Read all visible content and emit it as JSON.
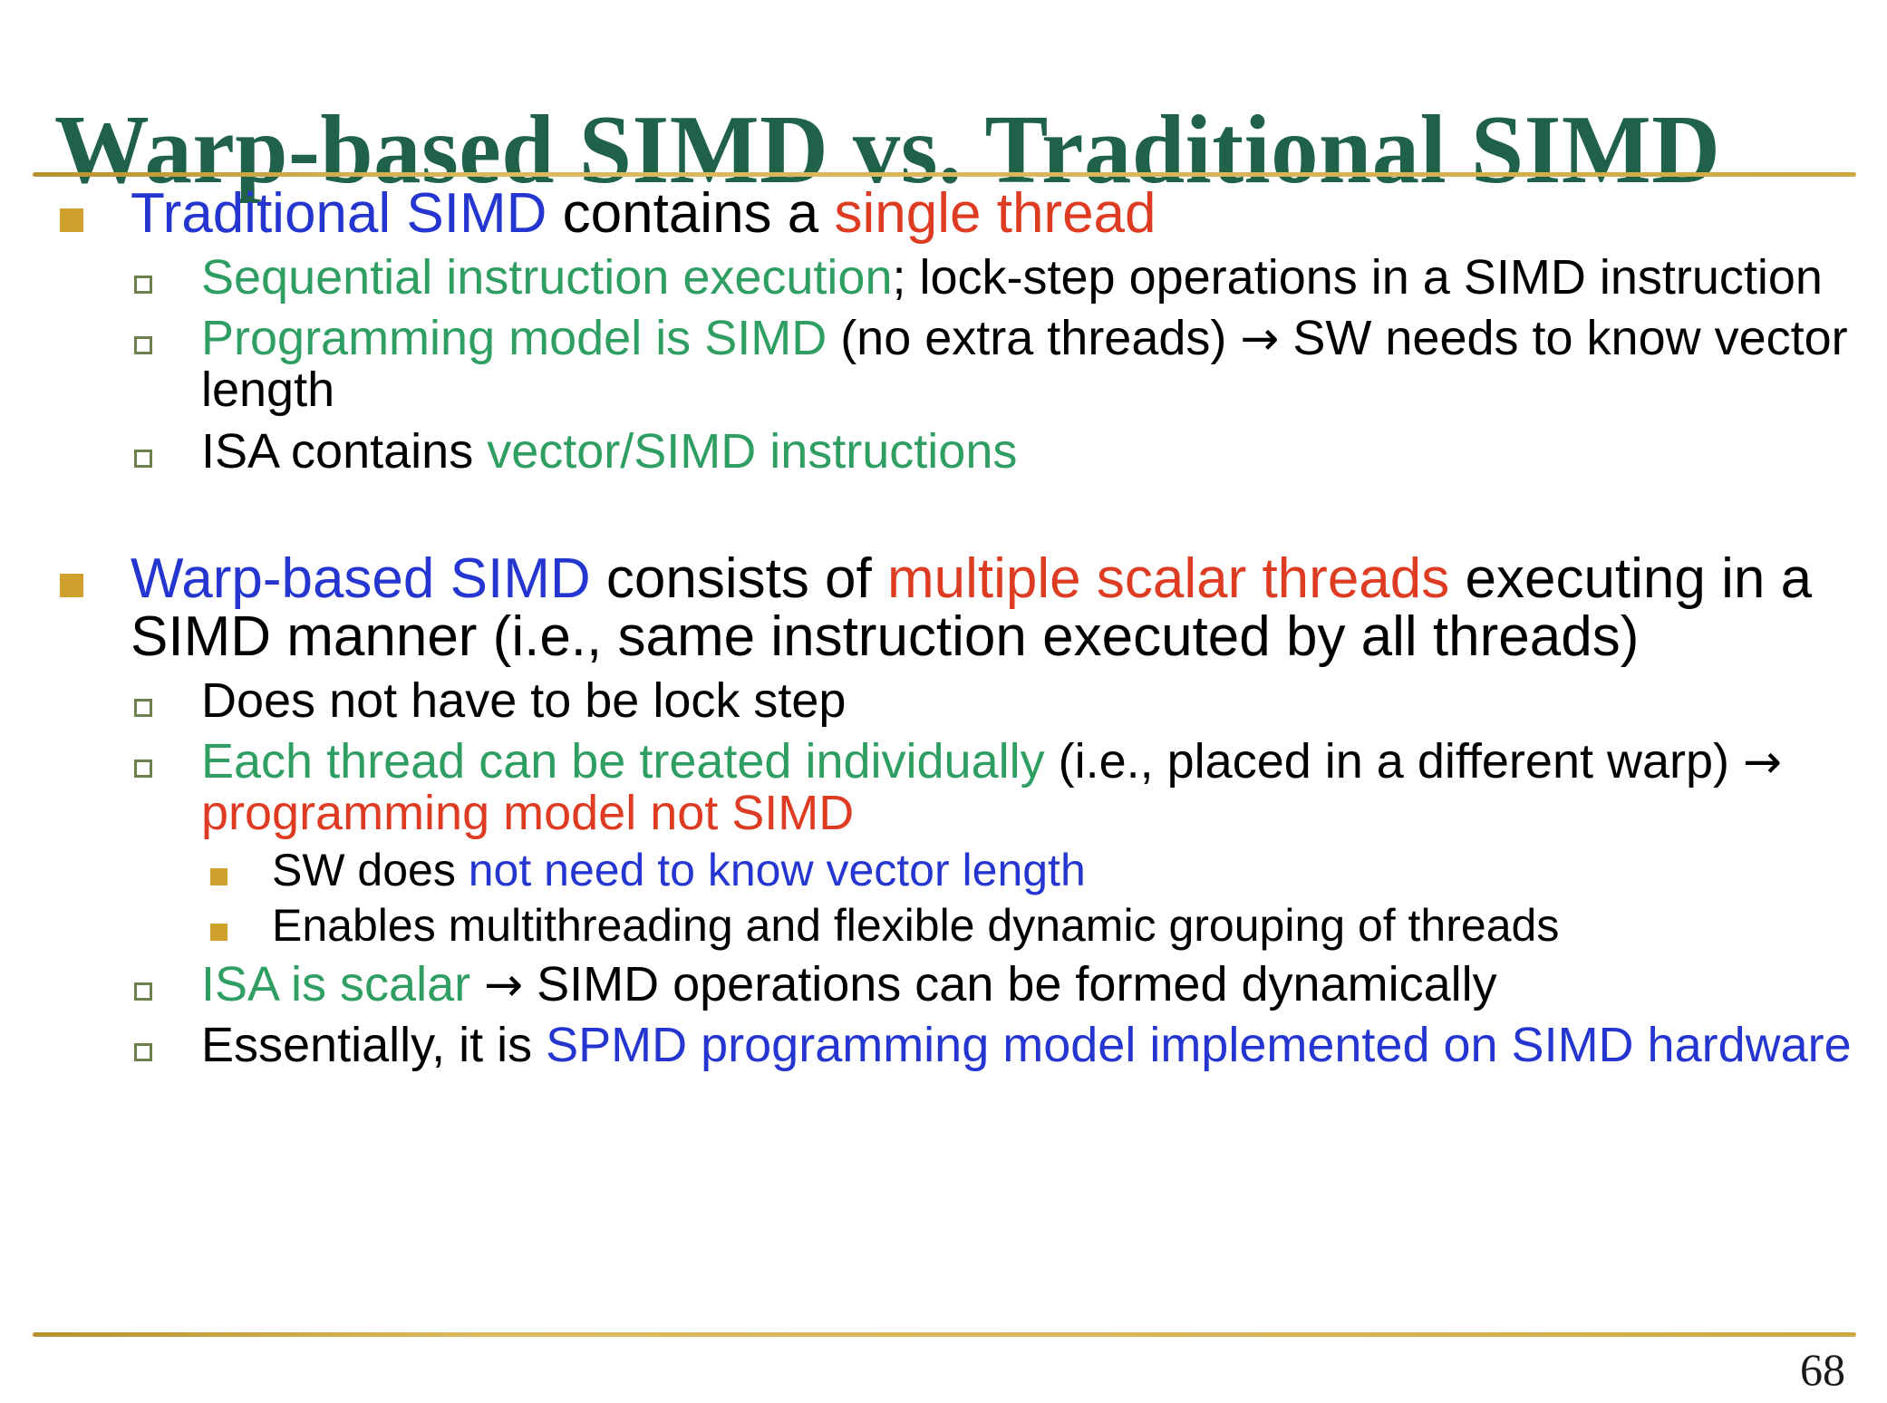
{
  "slide": {
    "title": "Warp-based SIMD vs. Traditional SIMD",
    "page_number": "68",
    "colors": {
      "title": "#1f6149",
      "rule": "#d4af47",
      "blue": "#2436cf",
      "red": "#de3c22",
      "green": "#2f9e62",
      "black": "#000000",
      "bullet_level1": "#cfa02b",
      "bullet_level2_border": "#6d7f4a",
      "bullet_level3": "#cfa02b",
      "background": "#ffffff"
    },
    "bullets": {
      "b1": {
        "level": 1,
        "marker": "filled-square-gold",
        "runs": [
          {
            "text": "Traditional SIMD",
            "color": "blue"
          },
          {
            "text": " contains a ",
            "color": "black"
          },
          {
            "text": "single thread",
            "color": "red"
          }
        ]
      },
      "b1s1": {
        "level": 2,
        "marker": "hollow-square-green",
        "runs": [
          {
            "text": "Sequential instruction execution",
            "color": "green"
          },
          {
            "text": "; lock-step operations in a SIMD instruction",
            "color": "black"
          }
        ]
      },
      "b1s2": {
        "level": 2,
        "marker": "hollow-square-green",
        "runs": [
          {
            "text": "Programming model is SIMD",
            "color": "green"
          },
          {
            "text": " (no extra threads) ",
            "color": "black"
          },
          {
            "text": "→",
            "color": "black"
          },
          {
            "text": " SW needs to know vector length",
            "color": "black"
          }
        ]
      },
      "b1s3": {
        "level": 2,
        "marker": "hollow-square-green",
        "runs": [
          {
            "text": "ISA contains ",
            "color": "black"
          },
          {
            "text": "vector/SIMD instructions",
            "color": "green"
          }
        ]
      },
      "b2": {
        "level": 1,
        "marker": "filled-square-gold",
        "runs": [
          {
            "text": "Warp-based SIMD",
            "color": "blue"
          },
          {
            "text": " consists of ",
            "color": "black"
          },
          {
            "text": "multiple scalar threads",
            "color": "red"
          },
          {
            "text": " executing in a SIMD manner (i.e., same instruction executed by all threads)",
            "color": "black"
          }
        ]
      },
      "b2s1": {
        "level": 2,
        "marker": "hollow-square-green",
        "runs": [
          {
            "text": "Does not have to be lock step",
            "color": "black"
          }
        ]
      },
      "b2s2": {
        "level": 2,
        "marker": "hollow-square-green",
        "runs": [
          {
            "text": "Each thread can be treated individually",
            "color": "green"
          },
          {
            "text": " (i.e., placed in a different warp) ",
            "color": "black"
          },
          {
            "text": "→",
            "color": "black"
          },
          {
            "text": " programming model not SIMD",
            "color": "red"
          }
        ]
      },
      "b2s2a": {
        "level": 3,
        "marker": "filled-square-gold",
        "runs": [
          {
            "text": "SW does ",
            "color": "black"
          },
          {
            "text": "not need to know vector length",
            "color": "blue"
          }
        ]
      },
      "b2s2b": {
        "level": 3,
        "marker": "filled-square-gold",
        "runs": [
          {
            "text": "Enables multithreading and flexible dynamic grouping of threads",
            "color": "black"
          }
        ]
      },
      "b2s3": {
        "level": 2,
        "marker": "hollow-square-green",
        "runs": [
          {
            "text": "ISA is scalar",
            "color": "green"
          },
          {
            "text": " ",
            "color": "black"
          },
          {
            "text": "→",
            "color": "black"
          },
          {
            "text": " SIMD operations can be formed dynamically",
            "color": "black"
          }
        ]
      },
      "b2s4": {
        "level": 2,
        "marker": "hollow-square-green",
        "runs": [
          {
            "text": "Essentially, it is ",
            "color": "black"
          },
          {
            "text": "SPMD programming model implemented on SIMD hardware",
            "color": "blue"
          }
        ]
      }
    }
  }
}
